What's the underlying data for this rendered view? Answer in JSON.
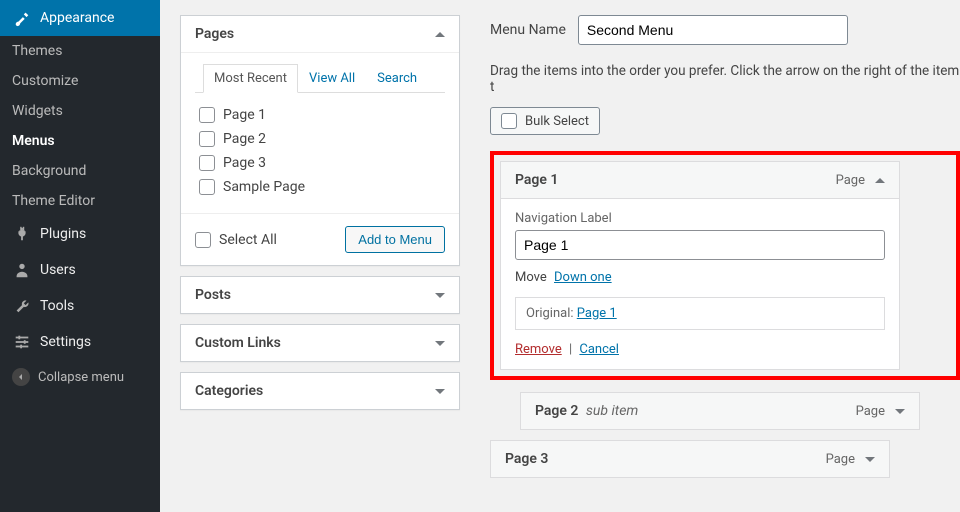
{
  "sidebar": {
    "appearance": "Appearance",
    "themes": "Themes",
    "customize": "Customize",
    "widgets": "Widgets",
    "menus": "Menus",
    "background": "Background",
    "theme_editor": "Theme Editor",
    "plugins": "Plugins",
    "users": "Users",
    "tools": "Tools",
    "settings": "Settings",
    "collapse": "Collapse menu"
  },
  "pages_box": {
    "title": "Pages",
    "tab_recent": "Most Recent",
    "tab_viewall": "View All",
    "tab_search": "Search",
    "items": [
      "Page 1",
      "Page 2",
      "Page 3",
      "Sample Page"
    ],
    "select_all": "Select All",
    "add_btn": "Add to Menu"
  },
  "posts_box": "Posts",
  "links_box": "Custom Links",
  "cats_box": "Categories",
  "menu": {
    "name_label": "Menu Name",
    "name_value": "Second Menu",
    "instructions": "Drag the items into the order you prefer. Click the arrow on the right of the item t",
    "bulk_select": "Bulk Select",
    "item1": {
      "title": "Page 1",
      "type": "Page",
      "nav_label_lbl": "Navigation Label",
      "nav_label_val": "Page 1",
      "move_lbl": "Move",
      "move_down": "Down one",
      "original_lbl": "Original:",
      "original_link": "Page 1",
      "remove": "Remove",
      "cancel": "Cancel"
    },
    "item2": {
      "title": "Page 2",
      "sub": "sub item",
      "type": "Page"
    },
    "item3": {
      "title": "Page 3",
      "type": "Page"
    }
  }
}
